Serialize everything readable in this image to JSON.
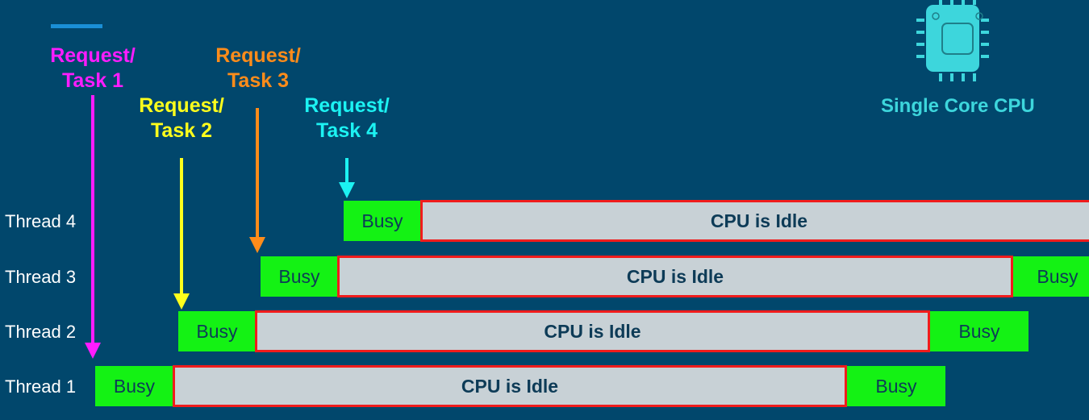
{
  "requests": [
    {
      "label_line1": "Request/",
      "label_line2": "Task 1",
      "color": "#ff1cff"
    },
    {
      "label_line1": "Request/",
      "label_line2": "Task 2",
      "color": "#ffff1c"
    },
    {
      "label_line1": "Request/",
      "label_line2": "Task 3",
      "color": "#ff8c1a"
    },
    {
      "label_line1": "Request/",
      "label_line2": "Task 4",
      "color": "#1cf2f2"
    }
  ],
  "cpu": {
    "label": "Single Core CPU",
    "icon": "cpu-chip-icon",
    "color": "#3dd6dc"
  },
  "threads": [
    {
      "label": "Thread 4",
      "busy": "Busy",
      "idle": "CPU is Idle"
    },
    {
      "label": "Thread 3",
      "busy": "Busy",
      "idle": "CPU is Idle",
      "busy_end": "Busy"
    },
    {
      "label": "Thread 2",
      "busy": "Busy",
      "idle": "CPU is Idle",
      "busy_end": "Busy"
    },
    {
      "label": "Thread 1",
      "busy": "Busy",
      "idle": "CPU is Idle",
      "busy_end": "Busy"
    }
  ]
}
